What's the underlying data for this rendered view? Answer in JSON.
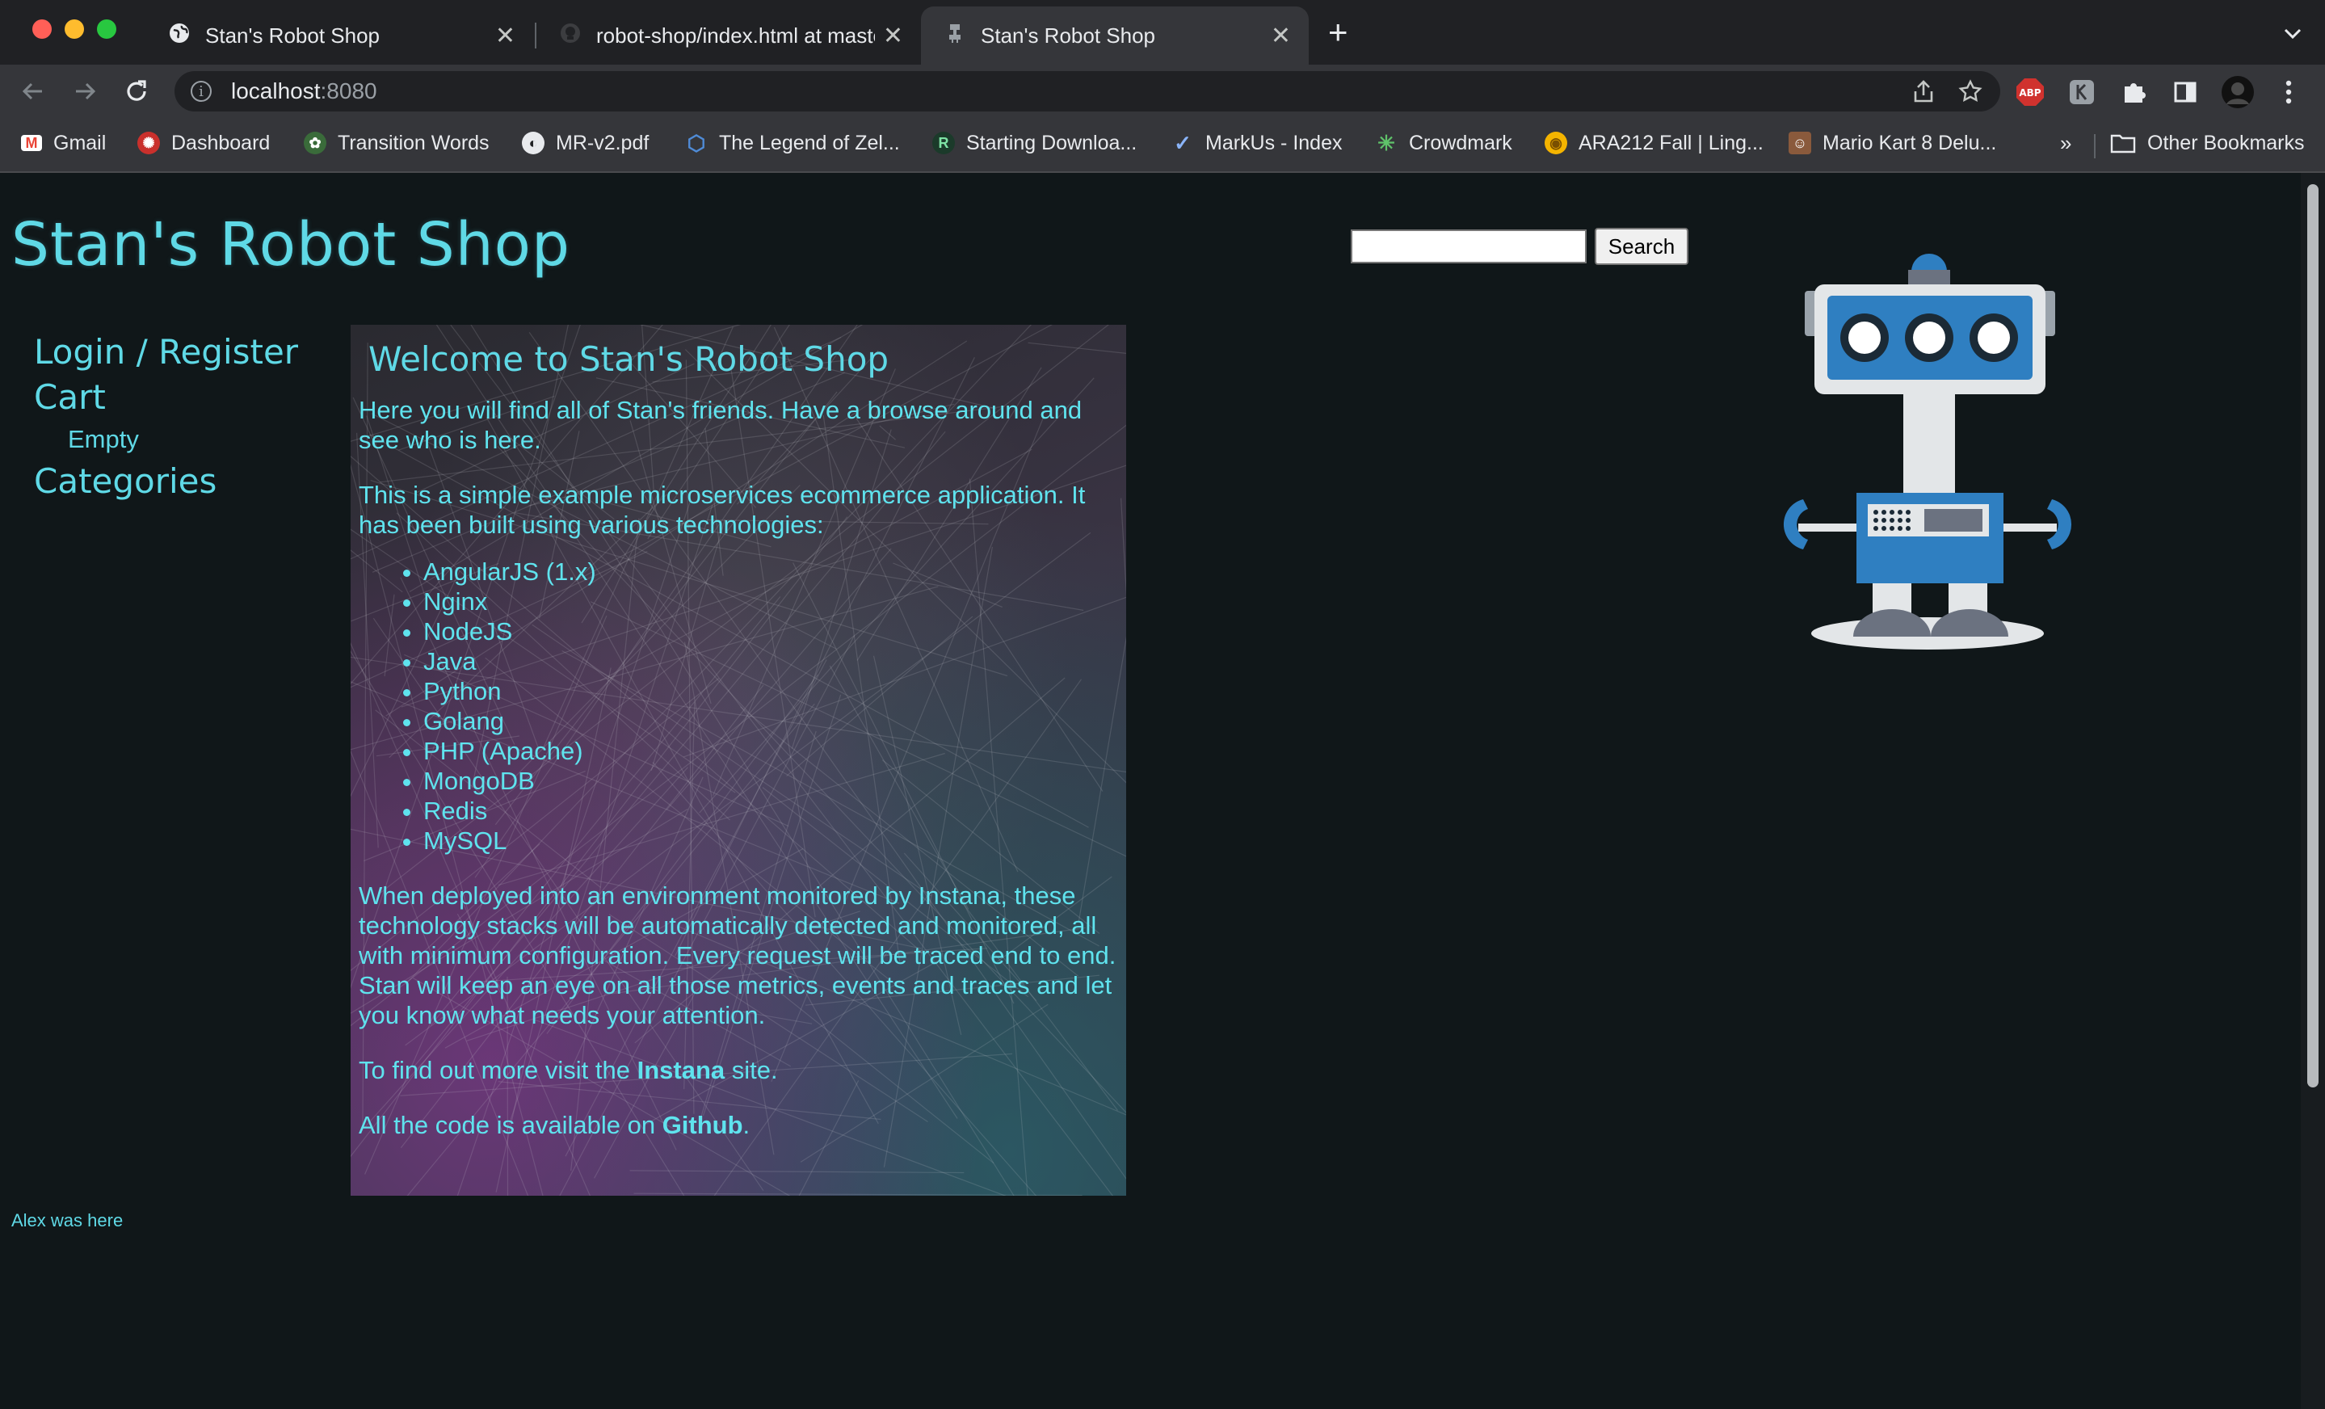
{
  "browser": {
    "tabs": [
      {
        "title": "Stan's Robot Shop",
        "active": false
      },
      {
        "title": "robot-shop/index.html at master",
        "active": false
      },
      {
        "title": "Stan's Robot Shop",
        "active": true
      }
    ],
    "url_host": "localhost",
    "url_port": ":8080",
    "bookmarks": [
      {
        "label": "Gmail",
        "icon": "gmail-icon"
      },
      {
        "label": "Dashboard",
        "icon": "dashboard-icon"
      },
      {
        "label": "Transition Words",
        "icon": "transition-words-icon"
      },
      {
        "label": "MR-v2.pdf",
        "icon": "globe-icon"
      },
      {
        "label": "The Legend of Zel...",
        "icon": "hexagon-icon"
      },
      {
        "label": "Starting Downloa...",
        "icon": "r-icon"
      },
      {
        "label": "MarkUs - Index",
        "icon": "check-icon"
      },
      {
        "label": "Crowdmark",
        "icon": "crowdmark-icon"
      },
      {
        "label": "ARA212 Fall | Ling...",
        "icon": "ara-icon"
      },
      {
        "label": "Mario Kart 8 Delu...",
        "icon": "mario-icon"
      }
    ],
    "other_bookmarks": "Other Bookmarks",
    "extensions": {
      "abp": "ABP"
    }
  },
  "page": {
    "site_title": "Stan's Robot Shop",
    "search": {
      "value": "",
      "button": "Search"
    },
    "nav": {
      "login": "Login / Register",
      "cart": "Cart",
      "cart_status": "Empty",
      "categories": "Categories"
    },
    "main": {
      "heading": "Welcome to Stan's Robot Shop",
      "intro": "Here you will find all of Stan's friends. Have a browse around and see who is here.",
      "tech_intro": "This is a simple example microservices ecommerce application. It has been built using various technologies:",
      "technologies": [
        "AngularJS (1.x)",
        "Nginx",
        "NodeJS",
        "Java",
        "Python",
        "Golang",
        "PHP (Apache)",
        "MongoDB",
        "Redis",
        "MySQL"
      ],
      "monitoring": "When deployed into an environment monitored by Instana, these technology stacks will be automatically detected and monitored, all with minimum configuration. Every request will be traced end to end. Stan will keep an eye on all those metrics, events and traces and let you know what needs your attention.",
      "more_prefix": "To find out more visit the ",
      "more_link": "Instana",
      "more_suffix": " site.",
      "code_prefix": "All the code is available on ",
      "code_link": "Github",
      "code_suffix": "."
    },
    "footer": "Alex was here"
  },
  "colors": {
    "accent": "#5fd9e6",
    "background": "#101719",
    "chrome": "#35363a"
  }
}
